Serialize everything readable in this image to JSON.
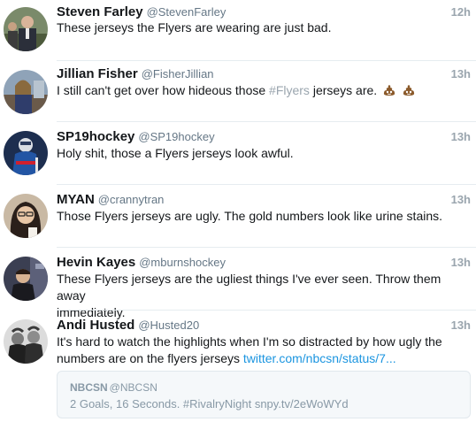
{
  "tweets": [
    {
      "name": "Steven Farley",
      "handle": "@StevenFarley",
      "time": "12h",
      "text": "These jerseys the Flyers are wearing are just bad."
    },
    {
      "name": "Jillian Fisher",
      "handle": "@FisherJillian",
      "time": "13h",
      "text_before": "I still can't get over how hideous those ",
      "hashtag": "#Flyers",
      "text_after": " jerseys are."
    },
    {
      "name": "SP19hockey",
      "handle": "@SP19hockey",
      "time": "13h",
      "text": "Holy shit, those a Flyers jerseys look awful."
    },
    {
      "name": "MYAN",
      "handle": "@crannytran",
      "time": "13h",
      "text": "Those Flyers jerseys are ugly. The gold numbers look like urine stains."
    },
    {
      "name": "Hevin Kayes",
      "handle": "@mburnshockey",
      "time": "13h",
      "text_line1": "These Flyers jerseys are the ugliest things I've ever seen. Throw them away",
      "text_line2": "immediately."
    },
    {
      "name": "Andi Husted",
      "handle": "@Husted20",
      "time": "13h",
      "text_line1": "It's hard to watch the highlights when I'm so distracted by how ugly the",
      "text_line2": "numbers are on the flyers jerseys ",
      "link": "twitter.com/nbcsn/status/7..."
    }
  ],
  "quote": {
    "name": "NBCSN",
    "handle": "@NBCSN",
    "text": "2 Goals, 16 Seconds. #RivalryNight snpy.tv/2eWoWYd"
  },
  "icons": {
    "emoji": "pile-of-poo-icon"
  },
  "colors": {
    "link": "#1b95e0",
    "muted": "#9aa5ae",
    "separator": "#e6ecf0"
  }
}
